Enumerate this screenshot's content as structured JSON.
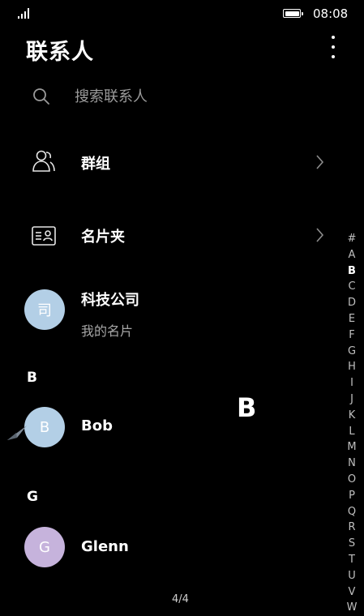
{
  "status_bar": {
    "time": "08:08"
  },
  "header": {
    "title": "联系人"
  },
  "search": {
    "placeholder": "搜索联系人"
  },
  "entries": [
    {
      "label": "群组",
      "icon": "group-icon"
    },
    {
      "label": "名片夹",
      "icon": "business-card-icon"
    }
  ],
  "contacts": {
    "my_card": {
      "avatar_text": "司",
      "name": "科技公司",
      "subtitle": "我的名片",
      "avatar_color": "#b3cfe6"
    },
    "sections": [
      {
        "letter": "B",
        "contacts": [
          {
            "avatar_text": "B",
            "name": "Bob",
            "avatar_color": "#b3cfe6"
          }
        ]
      },
      {
        "letter": "G",
        "contacts": [
          {
            "avatar_text": "G",
            "name": "Glenn",
            "avatar_color": "#c6b3dc"
          }
        ]
      }
    ]
  },
  "index_bar": {
    "letters": [
      "#",
      "A",
      "B",
      "C",
      "D",
      "E",
      "F",
      "G",
      "H",
      "I",
      "J",
      "K",
      "L",
      "M",
      "N",
      "O",
      "P",
      "Q",
      "R",
      "S",
      "T",
      "U",
      "V",
      "W"
    ],
    "active": "B"
  },
  "letter_popup": "B",
  "page_indicator": "4/4"
}
